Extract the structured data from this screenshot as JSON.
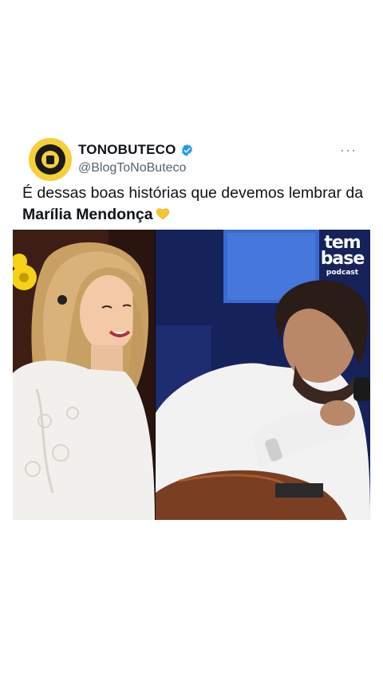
{
  "tweet": {
    "display_name": "TONOBUTECO",
    "handle": "@BlogToNoButeco",
    "more": "···",
    "text_part1": "É dessas boas histórias que devemos lembrar da ",
    "text_bold": "Marília Mendonça",
    "verified_color": "#1d9bf0"
  },
  "media": {
    "podcast_logo_line1": "tem",
    "podcast_logo_line2": "base",
    "podcast_logo_line3": "podcast"
  }
}
